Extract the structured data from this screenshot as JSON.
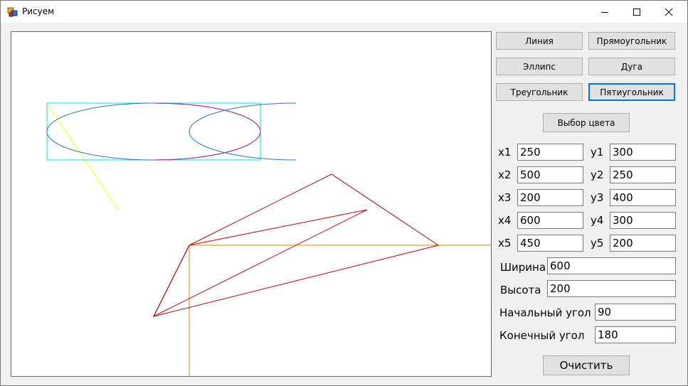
{
  "window": {
    "title": "Рисуем"
  },
  "buttons": {
    "line": "Линия",
    "rectangle": "Прямоугольник",
    "ellipse": "Эллипс",
    "arc": "Дуга",
    "triangle": "Треугольник",
    "pentagon": "Пятиугольник",
    "color": "Выбор цвета",
    "clear": "Очистить"
  },
  "fields": {
    "x1": {
      "label": "x1",
      "value": "250"
    },
    "y1": {
      "label": "y1",
      "value": "300"
    },
    "x2": {
      "label": "x2",
      "value": "500"
    },
    "y2": {
      "label": "y2",
      "value": "250"
    },
    "x3": {
      "label": "x3",
      "value": "200"
    },
    "y3": {
      "label": "y3",
      "value": "400"
    },
    "x4": {
      "label": "x4",
      "value": "600"
    },
    "y4": {
      "label": "y4",
      "value": "300"
    },
    "x5": {
      "label": "x5",
      "value": "450"
    },
    "y5": {
      "label": "y5",
      "value": "200"
    },
    "width": {
      "label": "Ширина",
      "value": "600"
    },
    "height": {
      "label": "Высота",
      "value": "200"
    },
    "start_angle": {
      "label": "Начальный угол",
      "value": "90"
    },
    "end_angle": {
      "label": "Конечный угол",
      "value": "180"
    }
  },
  "colors": {
    "line": "#ffff00",
    "rectangle": "#00e0e0",
    "ellipse": "#1e78d2",
    "arc": "#c0208c",
    "polygon": "#c00000",
    "axes": "#e08000",
    "focus": "#0078d7"
  }
}
